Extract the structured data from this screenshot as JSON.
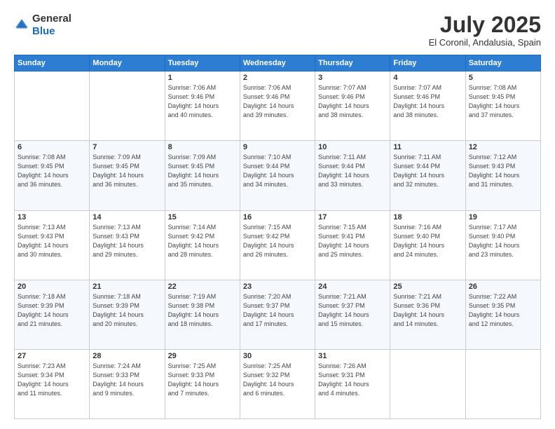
{
  "logo": {
    "general": "General",
    "blue": "Blue"
  },
  "header": {
    "month": "July 2025",
    "location": "El Coronil, Andalusia, Spain"
  },
  "weekdays": [
    "Sunday",
    "Monday",
    "Tuesday",
    "Wednesday",
    "Thursday",
    "Friday",
    "Saturday"
  ],
  "weeks": [
    [
      {
        "day": "",
        "sunrise": "",
        "sunset": "",
        "daylight": ""
      },
      {
        "day": "",
        "sunrise": "",
        "sunset": "",
        "daylight": ""
      },
      {
        "day": "1",
        "sunrise": "Sunrise: 7:06 AM",
        "sunset": "Sunset: 9:46 PM",
        "daylight": "Daylight: 14 hours and 40 minutes."
      },
      {
        "day": "2",
        "sunrise": "Sunrise: 7:06 AM",
        "sunset": "Sunset: 9:46 PM",
        "daylight": "Daylight: 14 hours and 39 minutes."
      },
      {
        "day": "3",
        "sunrise": "Sunrise: 7:07 AM",
        "sunset": "Sunset: 9:46 PM",
        "daylight": "Daylight: 14 hours and 38 minutes."
      },
      {
        "day": "4",
        "sunrise": "Sunrise: 7:07 AM",
        "sunset": "Sunset: 9:46 PM",
        "daylight": "Daylight: 14 hours and 38 minutes."
      },
      {
        "day": "5",
        "sunrise": "Sunrise: 7:08 AM",
        "sunset": "Sunset: 9:45 PM",
        "daylight": "Daylight: 14 hours and 37 minutes."
      }
    ],
    [
      {
        "day": "6",
        "sunrise": "Sunrise: 7:08 AM",
        "sunset": "Sunset: 9:45 PM",
        "daylight": "Daylight: 14 hours and 36 minutes."
      },
      {
        "day": "7",
        "sunrise": "Sunrise: 7:09 AM",
        "sunset": "Sunset: 9:45 PM",
        "daylight": "Daylight: 14 hours and 36 minutes."
      },
      {
        "day": "8",
        "sunrise": "Sunrise: 7:09 AM",
        "sunset": "Sunset: 9:45 PM",
        "daylight": "Daylight: 14 hours and 35 minutes."
      },
      {
        "day": "9",
        "sunrise": "Sunrise: 7:10 AM",
        "sunset": "Sunset: 9:44 PM",
        "daylight": "Daylight: 14 hours and 34 minutes."
      },
      {
        "day": "10",
        "sunrise": "Sunrise: 7:11 AM",
        "sunset": "Sunset: 9:44 PM",
        "daylight": "Daylight: 14 hours and 33 minutes."
      },
      {
        "day": "11",
        "sunrise": "Sunrise: 7:11 AM",
        "sunset": "Sunset: 9:44 PM",
        "daylight": "Daylight: 14 hours and 32 minutes."
      },
      {
        "day": "12",
        "sunrise": "Sunrise: 7:12 AM",
        "sunset": "Sunset: 9:43 PM",
        "daylight": "Daylight: 14 hours and 31 minutes."
      }
    ],
    [
      {
        "day": "13",
        "sunrise": "Sunrise: 7:13 AM",
        "sunset": "Sunset: 9:43 PM",
        "daylight": "Daylight: 14 hours and 30 minutes."
      },
      {
        "day": "14",
        "sunrise": "Sunrise: 7:13 AM",
        "sunset": "Sunset: 9:43 PM",
        "daylight": "Daylight: 14 hours and 29 minutes."
      },
      {
        "day": "15",
        "sunrise": "Sunrise: 7:14 AM",
        "sunset": "Sunset: 9:42 PM",
        "daylight": "Daylight: 14 hours and 28 minutes."
      },
      {
        "day": "16",
        "sunrise": "Sunrise: 7:15 AM",
        "sunset": "Sunset: 9:42 PM",
        "daylight": "Daylight: 14 hours and 26 minutes."
      },
      {
        "day": "17",
        "sunrise": "Sunrise: 7:15 AM",
        "sunset": "Sunset: 9:41 PM",
        "daylight": "Daylight: 14 hours and 25 minutes."
      },
      {
        "day": "18",
        "sunrise": "Sunrise: 7:16 AM",
        "sunset": "Sunset: 9:40 PM",
        "daylight": "Daylight: 14 hours and 24 minutes."
      },
      {
        "day": "19",
        "sunrise": "Sunrise: 7:17 AM",
        "sunset": "Sunset: 9:40 PM",
        "daylight": "Daylight: 14 hours and 23 minutes."
      }
    ],
    [
      {
        "day": "20",
        "sunrise": "Sunrise: 7:18 AM",
        "sunset": "Sunset: 9:39 PM",
        "daylight": "Daylight: 14 hours and 21 minutes."
      },
      {
        "day": "21",
        "sunrise": "Sunrise: 7:18 AM",
        "sunset": "Sunset: 9:39 PM",
        "daylight": "Daylight: 14 hours and 20 minutes."
      },
      {
        "day": "22",
        "sunrise": "Sunrise: 7:19 AM",
        "sunset": "Sunset: 9:38 PM",
        "daylight": "Daylight: 14 hours and 18 minutes."
      },
      {
        "day": "23",
        "sunrise": "Sunrise: 7:20 AM",
        "sunset": "Sunset: 9:37 PM",
        "daylight": "Daylight: 14 hours and 17 minutes."
      },
      {
        "day": "24",
        "sunrise": "Sunrise: 7:21 AM",
        "sunset": "Sunset: 9:37 PM",
        "daylight": "Daylight: 14 hours and 15 minutes."
      },
      {
        "day": "25",
        "sunrise": "Sunrise: 7:21 AM",
        "sunset": "Sunset: 9:36 PM",
        "daylight": "Daylight: 14 hours and 14 minutes."
      },
      {
        "day": "26",
        "sunrise": "Sunrise: 7:22 AM",
        "sunset": "Sunset: 9:35 PM",
        "daylight": "Daylight: 14 hours and 12 minutes."
      }
    ],
    [
      {
        "day": "27",
        "sunrise": "Sunrise: 7:23 AM",
        "sunset": "Sunset: 9:34 PM",
        "daylight": "Daylight: 14 hours and 11 minutes."
      },
      {
        "day": "28",
        "sunrise": "Sunrise: 7:24 AM",
        "sunset": "Sunset: 9:33 PM",
        "daylight": "Daylight: 14 hours and 9 minutes."
      },
      {
        "day": "29",
        "sunrise": "Sunrise: 7:25 AM",
        "sunset": "Sunset: 9:33 PM",
        "daylight": "Daylight: 14 hours and 7 minutes."
      },
      {
        "day": "30",
        "sunrise": "Sunrise: 7:25 AM",
        "sunset": "Sunset: 9:32 PM",
        "daylight": "Daylight: 14 hours and 6 minutes."
      },
      {
        "day": "31",
        "sunrise": "Sunrise: 7:26 AM",
        "sunset": "Sunset: 9:31 PM",
        "daylight": "Daylight: 14 hours and 4 minutes."
      },
      {
        "day": "",
        "sunrise": "",
        "sunset": "",
        "daylight": ""
      },
      {
        "day": "",
        "sunrise": "",
        "sunset": "",
        "daylight": ""
      }
    ]
  ]
}
